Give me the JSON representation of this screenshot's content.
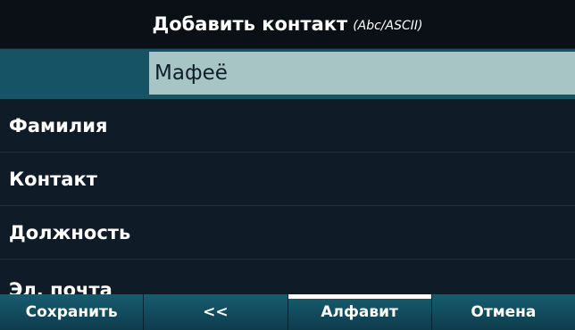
{
  "header": {
    "title": "Добавить контакт",
    "input_mode": "(Abc/ASCII)"
  },
  "selected_field": {
    "value": "Мафеё"
  },
  "fields": [
    {
      "label": "Фамилия"
    },
    {
      "label": "Контакт"
    },
    {
      "label": "Должность"
    },
    {
      "label": "Эл. почта"
    }
  ],
  "softkeys": [
    {
      "label": "Сохранить"
    },
    {
      "label": "<<"
    },
    {
      "label": "Алфавит",
      "active": true
    },
    {
      "label": "Отмена"
    }
  ],
  "colors": {
    "header_bg": "#0a1016",
    "list_bg": "#0f1b27",
    "selected_row": "#165364",
    "input_bg": "#a6c5c4",
    "softkey_bg": "#175c70",
    "text": "#ffffff"
  }
}
